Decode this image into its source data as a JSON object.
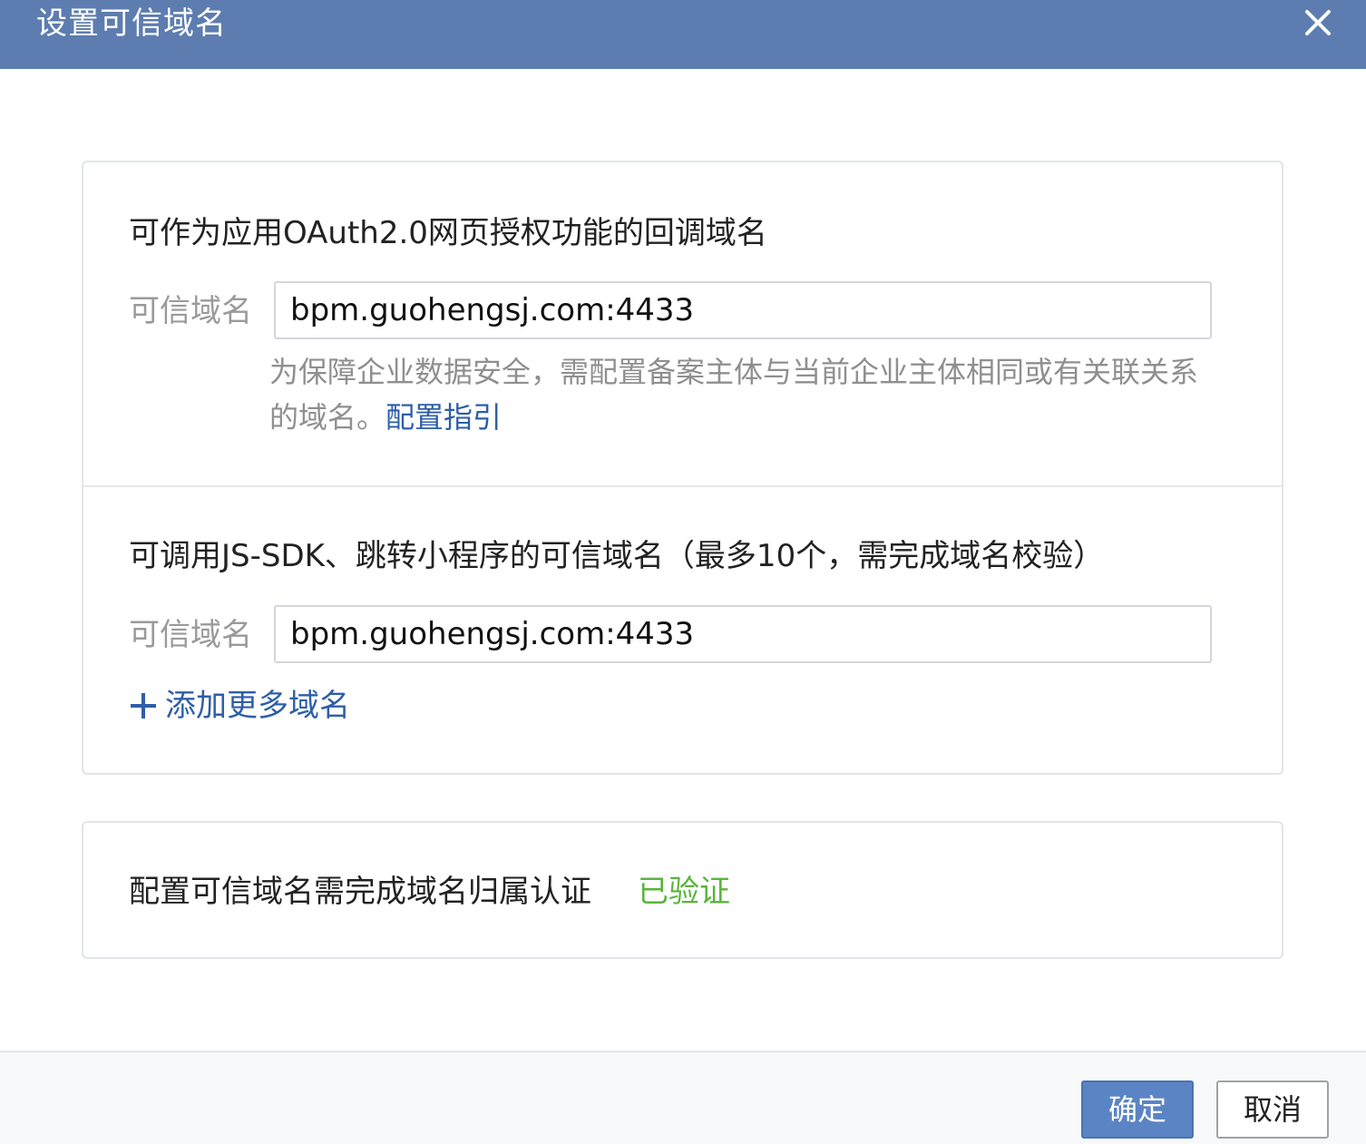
{
  "dialog": {
    "title": "设置可信域名",
    "close_icon": "close-icon"
  },
  "oauth_section": {
    "title": "可作为应用OAuth2.0网页授权功能的回调域名",
    "field_label": "可信域名",
    "domain_value": "bpm.guohengsj.com:4433",
    "hint_text": "为保障企业数据安全，需配置备案主体与当前企业主体相同或有关联关系的域名。",
    "hint_link": "配置指引"
  },
  "jssdk_section": {
    "title": "可调用JS-SDK、跳转小程序的可信域名（最多10个，需完成域名校验）",
    "field_label": "可信域名",
    "domain_value": "bpm.guohengsj.com:4433",
    "add_more_label": "添加更多域名",
    "add_icon": "plus-icon"
  },
  "verification": {
    "text": "配置可信域名需完成域名归属认证",
    "status": "已验证",
    "status_color": "#5bb43e"
  },
  "footer": {
    "confirm_label": "确定",
    "cancel_label": "取消"
  },
  "colors": {
    "header": "#5d7db0",
    "link": "#2e5ea8",
    "primary_button": "#5b84c4"
  }
}
